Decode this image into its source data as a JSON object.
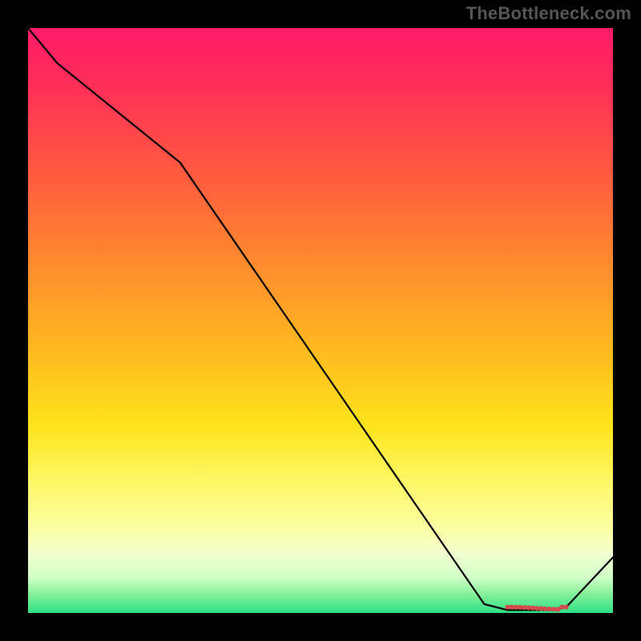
{
  "watermark": "TheBottleneck.com",
  "chart_data": {
    "type": "line",
    "title": "",
    "xlabel": "",
    "ylabel": "",
    "x": [
      0.0,
      0.05,
      0.26,
      0.78,
      0.82,
      0.84,
      0.86,
      0.88,
      0.9,
      0.92,
      1.0
    ],
    "values": [
      1.0,
      0.94,
      0.77,
      0.015,
      0.005,
      0.005,
      0.005,
      0.005,
      0.005,
      0.01,
      0.095
    ],
    "xlim": [
      0,
      1
    ],
    "ylim": [
      0,
      1
    ],
    "marker_band": {
      "x_start": 0.82,
      "x_end": 0.92,
      "y": 0.008,
      "color": "#d54a4a"
    },
    "gradient_stops": [
      {
        "pos": 0.0,
        "color": "#ff1a6a"
      },
      {
        "pos": 0.4,
        "color": "#ff8a2e"
      },
      {
        "pos": 0.68,
        "color": "#ffe31c"
      },
      {
        "pos": 0.9,
        "color": "#f2ffd1"
      },
      {
        "pos": 1.0,
        "color": "#2fe086"
      }
    ]
  }
}
